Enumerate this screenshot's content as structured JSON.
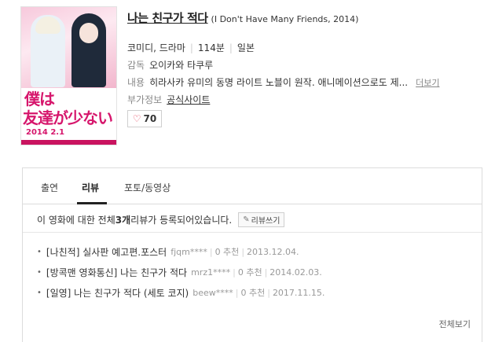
{
  "movie": {
    "title_kr": "나는 친구가 적다",
    "title_en": "(I Don't Have Many Friends, 2014)",
    "genre": "코미디, 드라마",
    "runtime": "114분",
    "country": "일본",
    "director_label": "감독",
    "director": "오이카와 타쿠루",
    "info_label": "내용",
    "info": "히라사카 유미의 동명 라이트 노블이 원작. 애니메이션으로도 제...",
    "more_label": "더보기",
    "extra_label": "부가정보",
    "extra_value": "공식사이트",
    "likes": "70"
  },
  "poster": {
    "title_line1": "僕は",
    "title_line2": "友達が少ない",
    "release_date": "2014 2.1"
  },
  "tabs": [
    {
      "label": "출연"
    },
    {
      "label": "리뷰"
    },
    {
      "label": "포토/동영상"
    }
  ],
  "summary": {
    "prefix": "이 영화에 대한 전체 ",
    "count": "3개",
    "suffix": " 리뷰가 등록되어있습니다.",
    "write_label": "리뷰쓰기"
  },
  "reviews": [
    {
      "title": "[나친적] 실사판 예고편.포스터",
      "user": "fjqm****",
      "rec": "0 추천",
      "date": "2013.12.04."
    },
    {
      "title": "[방콕맨 영화통신] 나는 친구가 적다",
      "user": "mrz1****",
      "rec": "0 추천",
      "date": "2014.02.03."
    },
    {
      "title": "[일영] 나는 친구가 적다 (세토 코지)",
      "user": "beew****",
      "rec": "0 추천",
      "date": "2017.11.15."
    }
  ],
  "view_all": "전체보기",
  "colors": {
    "accent": "#d6166c",
    "heart": "#e3354f"
  }
}
